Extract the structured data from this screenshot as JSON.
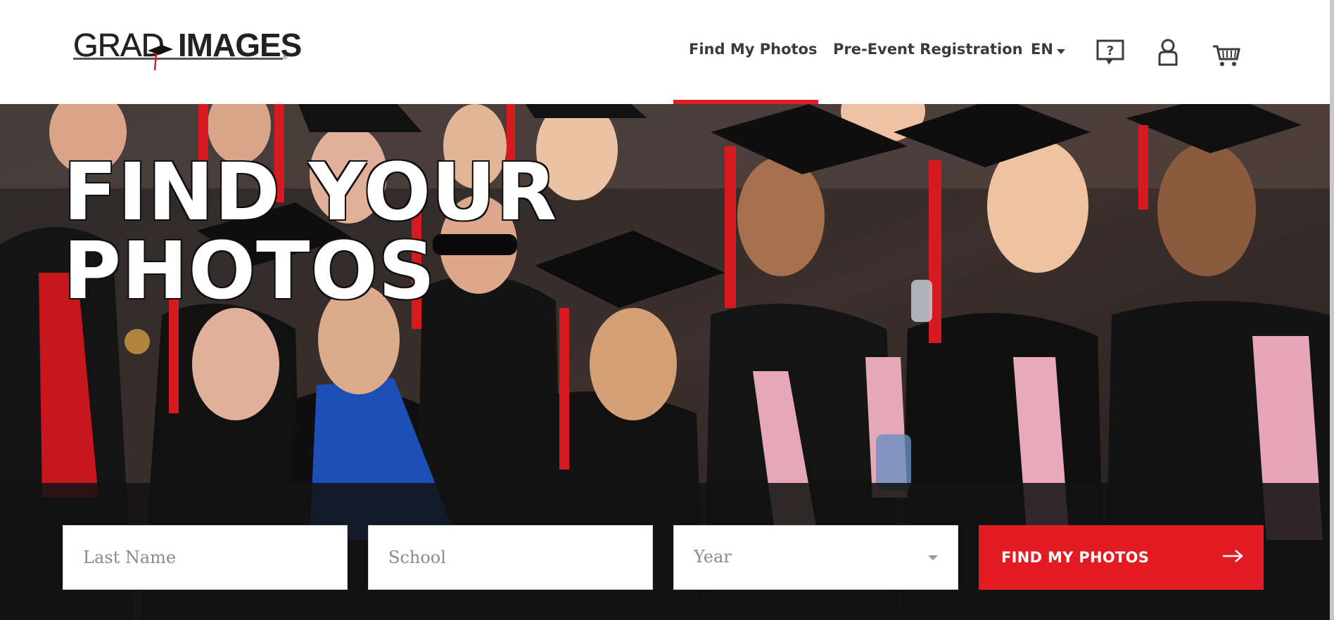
{
  "brand": {
    "logo_text_grad": "GRAD",
    "logo_text_images": "IMAGES",
    "logo_mark": "®",
    "accent_color": "#e31b23"
  },
  "nav": {
    "find_my_photos": "Find My Photos",
    "pre_event_registration": "Pre-Event Registration",
    "language": "EN",
    "active_item": "Find My Photos",
    "icons": {
      "help": "help-question-icon",
      "account": "user-account-icon",
      "cart": "shopping-cart-icon"
    },
    "help_glyph": "?"
  },
  "hero": {
    "title_line1": "FIND YOUR",
    "title_line2": "PHOTOS",
    "background": "graduates-group-photo"
  },
  "search": {
    "last_name_placeholder": "Last Name",
    "school_placeholder": "School",
    "year_placeholder": "Year",
    "button_label": "FIND MY PHOTOS",
    "button_icon": "arrow-right-icon"
  }
}
